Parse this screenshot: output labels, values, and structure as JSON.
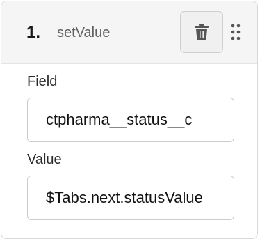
{
  "step": {
    "number": "1.",
    "name": "setValue",
    "delete_icon": "trash-icon",
    "drag_icon": "drag-handle-icon"
  },
  "fields": {
    "field": {
      "label": "Field",
      "value": "ctpharma__status__c"
    },
    "value": {
      "label": "Value",
      "value": "$Tabs.next.statusValue"
    }
  },
  "colors": {
    "header_bg": "#f5f5f5",
    "border": "#d8d8d8",
    "icon": "#555555"
  }
}
